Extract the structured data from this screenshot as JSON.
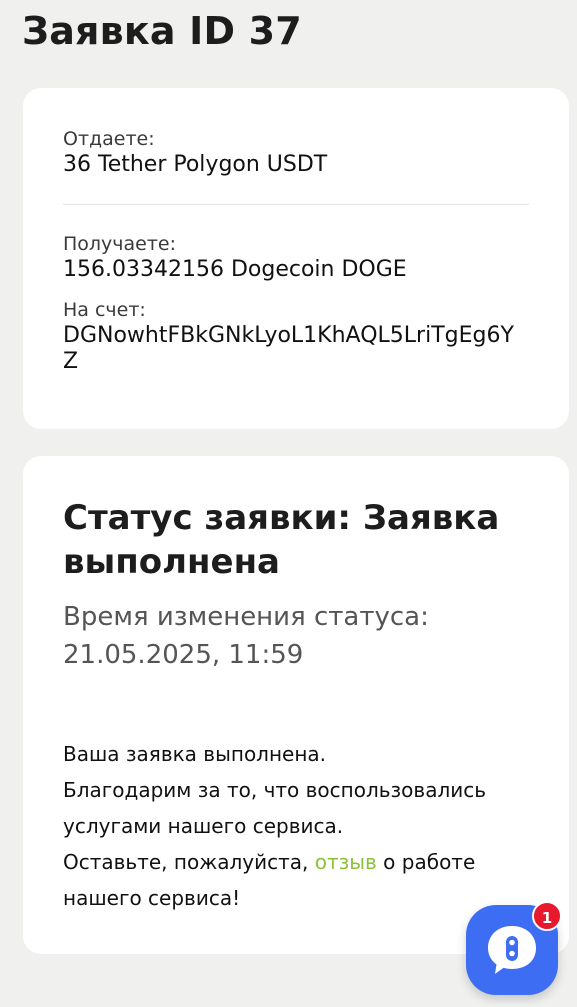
{
  "header": {
    "title": "Заявка ID 37"
  },
  "exchange": {
    "give_label": "Отдаете:",
    "give_value": "36 Tether Polygon USDT",
    "receive_label": "Получаете:",
    "receive_value": "156.03342156 Dogecoin DOGE",
    "account_label": "На счет:",
    "account_value": "DGNowhtFBkGNkLyoL1KhAQL5LriTgEg6YZ"
  },
  "status": {
    "heading": "Статус заявки: Заявка выполнена",
    "time_label": "Время изменения статуса:",
    "time_value": "21.05.2025, 11:59",
    "message_line1": "Ваша заявка выполнена.",
    "message_line2": "Благодарим за то, что воспользовались услугами нашего сервиса.",
    "message_line3_before": "Оставьте, пожалуйста, ",
    "message_link": "отзыв",
    "message_line3_after": " о работе нашего сервиса!"
  },
  "chat": {
    "icon": "chat-bubble-icon",
    "badge_count": "1",
    "colors": {
      "widget": "#3d6df2",
      "badge": "#e8192c"
    }
  },
  "colors": {
    "background": "#f0f1ef",
    "card": "#ffffff",
    "link": "#8cc23a"
  }
}
